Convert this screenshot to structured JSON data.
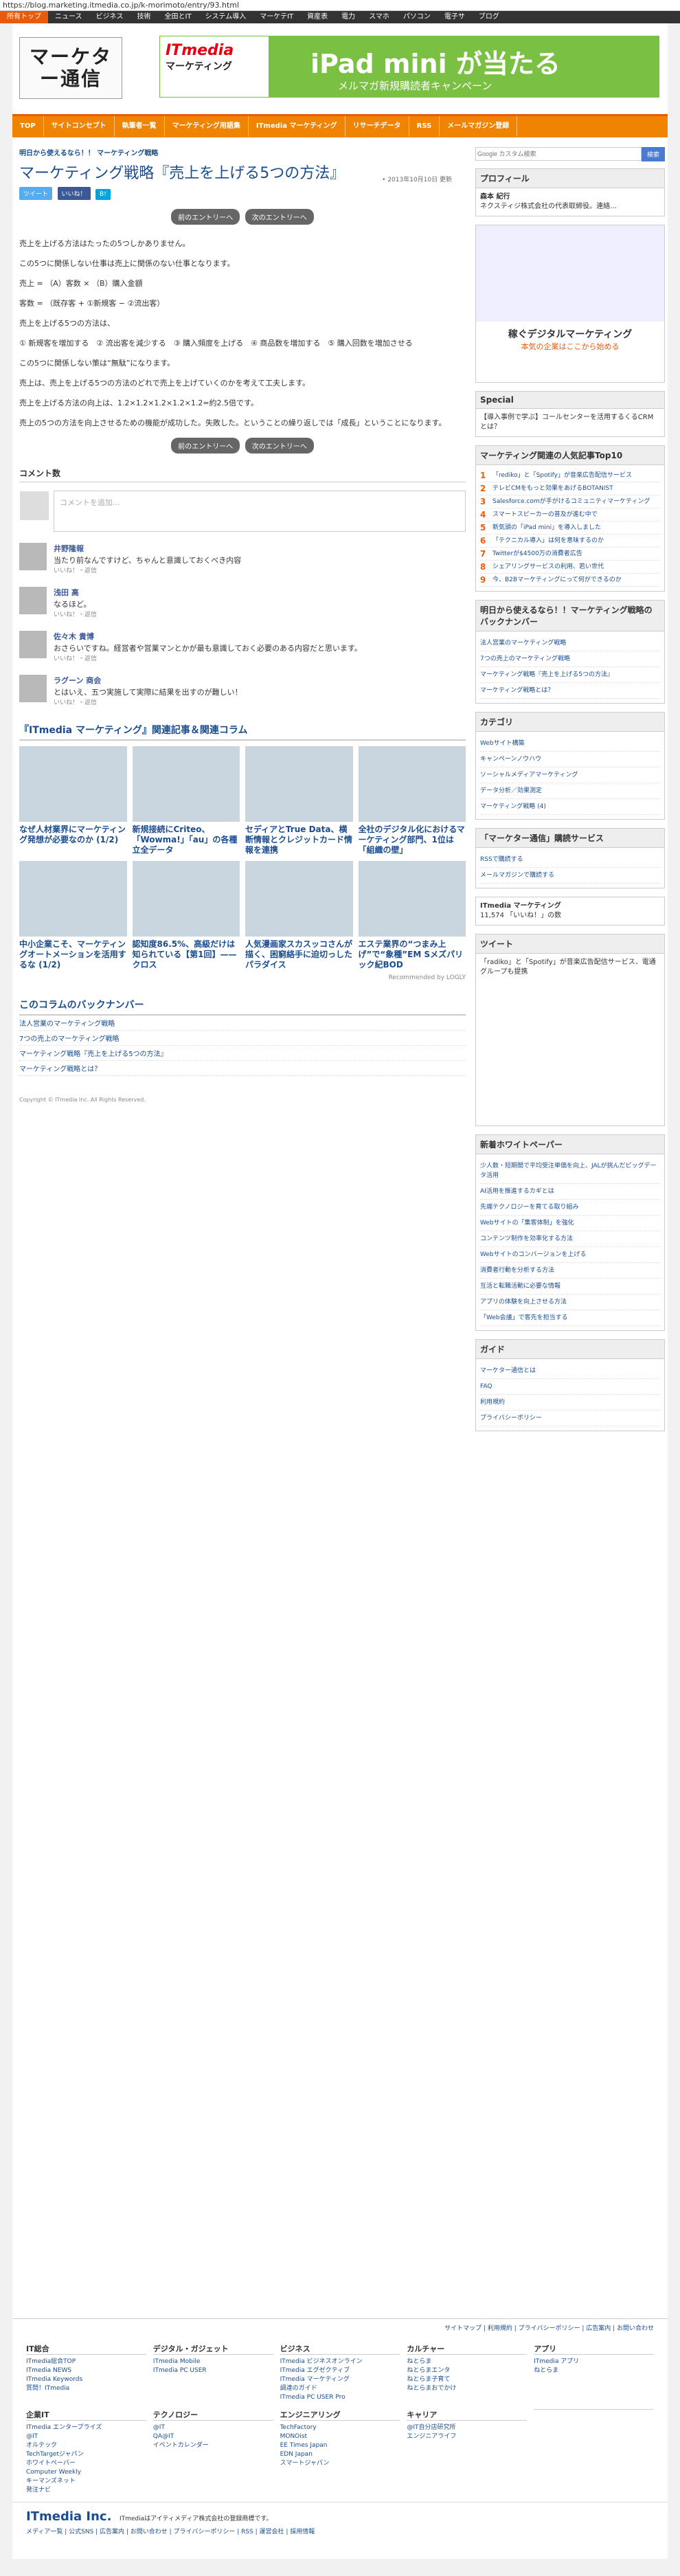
{
  "url": "https://blog.marketing.itmedia.co.jp/k-morimoto/entry/93.html",
  "topnav": [
    "所有トップ",
    "ニュース",
    "ビジネス",
    "技術",
    "全田とIT",
    "システム導入",
    "マーケテIT",
    "資産表",
    "電力",
    "スマホ",
    "パソコン",
    "電子サ",
    "ブログ"
  ],
  "logo": "マーケター通信",
  "banner": {
    "brand1": "ITmedia",
    "brand2": "マーケティング",
    "title": "iPad mini が当たる",
    "sub": "メルマガ新規購読者キャンペーン"
  },
  "orange": [
    "TOP",
    "サイトコンセプト",
    "執筆者一覧",
    "マーケティング用語集",
    "ITmedia マーケティング",
    "リサーチデータ",
    "RSS",
    "メールマガジン登録"
  ],
  "crumb": "明日から使えるなら！！ マーケティング戦略",
  "date": "• 2013年10月10日 更新",
  "title": "マーケティング戦略『売上を上げる5つの方法』",
  "pager": {
    "prev": "前のエントリーへ",
    "next": "次のエントリーへ"
  },
  "body": [
    "売上を上げる方法はたったの5つしかありません。",
    "この5つに関係しない仕事は売上に関係のない仕事となります。",
    "売上 = （A）客数 × （B）購入金額",
    "客数 = （既存客 + ①新規客 − ②流出客）",
    "売上を上げる5つの方法は、",
    "① 新規客を増加する　② 流出客を減少する　③ 購入頻度を上げる　④ 商品数を増加する　⑤ 購入回数を増加させる",
    "この5つに関係しない策は“無駄”になります。",
    "売上は、売上を上げる5つの方法のどれで売上を上げていくのかを考えて工夫します。",
    "売上を上げる方法の向上は、1.2×1.2×1.2×1.2×1.2=約2.5倍です。",
    "売上の5つの方法を向上させるための機能が成功した。失敗した。ということの繰り返しでは「成長」ということになります。"
  ],
  "comments": {
    "header": "コメント数",
    "placeholder": "コメントを追加...",
    "items": [
      {
        "name": "井野隆報",
        "text": "当たり前なんですけど、ちゃんと意識しておくべき内容",
        "meta": "いいね！・返信"
      },
      {
        "name": "浅田 高",
        "text": "なるほど。",
        "meta": "いいね！・返信"
      },
      {
        "name": "佐々木 貴博",
        "text": "おさらいですね。経営者や営業マンとかが最も意識しておく必要のある内容だと思います。",
        "meta": "いいね！・返信"
      },
      {
        "name": "ラグーン 商会",
        "text": "とはいえ、五つ実施して実際に結果を出すのが難しい！",
        "meta": "いいね！・返信"
      }
    ]
  },
  "related": {
    "header": "『ITmedia マーケティング』関連記事＆関連コラム",
    "cards": [
      "なぜ人材業界にマーケティング発想が必要なのか (1/2)",
      "新規接続にCriteo、「Wowma!」「au」の各種立全データ",
      "セディアとTrue Data、横断情報とクレジットカード情報を連携",
      "全社のデジタル化におけるマーケティング部門、1位は「組織の壁」",
      "中小企業こそ、マーケティングオートメーションを活用するな (1/2)",
      "認知度86.5%、高級だけは知られている【第1回】——クロス",
      "人気漫画家スカスッコさんが描く、困窮絡手に迫切っしたパラダイス",
      "エステ業界の“つまみ上げ”で“象種”EM Sメズパリック紀BOD"
    ],
    "recommended": "Recommended by LOGLY"
  },
  "backnum": {
    "header": "このコラムのバックナンバー",
    "items": [
      "法人営業のマーケティング戦略",
      "7つの売上のマーケティング戦略",
      "マーケティング戦略『売上を上げる5つの方法』",
      "マーケティング戦略とは？"
    ]
  },
  "copyright": "Copyright © ITmedia Inc. All Rights Reserved.",
  "side": {
    "search_placeholder": "Google カスタム検索",
    "search_btn": "検索",
    "profile_h": "プロフィール",
    "profile_name": "森本 紀行",
    "profile_text": "ネクスティジ株式会社の代表取締役。連絡…",
    "ad_title": "稼ぐデジタルマーケティング",
    "ad_sub": "本気の企業はここから始める",
    "special_h": "Special",
    "special_item": "【導入事例で学ぶ】コールセンターを活用するくるCRMとは？",
    "rank_h": "マーケティング関連の人気記事Top10",
    "rank": [
      "「rediko」と「Spotify」が音楽広告配信サービス",
      "テレビCMをもっと効果をあげるBOTANIST",
      "Salesforce.comが手がけるコミュニティマーケティング",
      "スマートスピーカーの普及が進む中で",
      "新気頭の「iPad mini」を導入しました",
      "「テクニカル導入」は何を意味するのか",
      "Twitterが$4500万の消費者広告",
      "シェアリングサービスの利用、若い世代",
      "今、B2Bマーケティングにって何ができるのか"
    ],
    "backnum_h": "明日から使えるなら！！マーケティング戦略のバックナンバー",
    "category_h": "カテゴリ",
    "categories": [
      "Webサイト構築",
      "キャンペーンノウハウ",
      "ソーシャルメディアマーケティング",
      "データ分析／効果測定",
      "マーケティング戦略 (4)"
    ],
    "subscribe_h": "「マーケター通信」購読サービス",
    "subscribe": [
      "RSSで購読する",
      "メールマガジンで購読する"
    ],
    "fb_name": "ITmedia マーケティング",
    "fb_count": "11,574 「いいね！」の数",
    "tweets_h": "ツイート",
    "tweet_text": "「radiko」と「Spotify」が音楽広告配信サービス、電通グループも提携",
    "wp_h": "新着ホワイトペーパー",
    "wp": [
      "少人数・短期間で平均受注単価を向上、JALが挑んだビッグデータ活用",
      "AI活用を推進するカギとは",
      "先端テクノロジーを育てる取り組み",
      "Webサイトの「集客体制」を強化",
      "コンテンツ制作を効率化する方法",
      "Webサイトのコンバージョンを上げる",
      "消費者行動を分析する方法",
      "互活と転職活動に必要な情報",
      "アプリの体験を向上させる方法",
      "「Web会議」で客先を担当する"
    ],
    "guide_h": "ガイド",
    "guide": [
      "マーケター通信とは",
      "FAQ",
      "利用規約",
      "プライバシーポリシー"
    ]
  },
  "footer": {
    "links": "サイトマップ | 利用規約 | プライバシーポリシー | 広告案内 | お問い合わせ",
    "cols": [
      {
        "h": "IT総合",
        "items": [
          "ITmedia総合TOP",
          "ITmedia NEWS",
          "ITmedia Keywords",
          "質問！ITmedia"
        ]
      },
      {
        "h": "デジタル・ガジェット",
        "items": [
          "ITmedia Mobile",
          "ITmedia PC USER"
        ]
      },
      {
        "h": "ビジネス",
        "items": [
          "ITmedia ビジネスオンライン",
          "ITmedia エグゼクティブ",
          "ITmedia マーケティング",
          "調達のガイド",
          "ITmedia PC USER Pro"
        ]
      },
      {
        "h": "カルチャー",
        "items": [
          "ねとらま",
          "ねとらまエンタ",
          "ねとらま子育て",
          "ねとらまおでかけ"
        ]
      },
      {
        "h": "アプリ",
        "items": [
          "ITmedia アプリ",
          "ねとらま"
        ]
      },
      {
        "h": "企業IT",
        "items": [
          "ITmedia エンタープライズ",
          "@IT",
          "オルテック",
          "TechTargetジャパン",
          "ホワイトペーパー",
          "Computer Weekly",
          "キーマンズネット",
          "発注ナビ"
        ]
      },
      {
        "h": "テクノロジー",
        "items": [
          "@IT",
          "QA@IT",
          "イベントカレンダー"
        ]
      },
      {
        "h": "エンジニアリング",
        "items": [
          "TechFactory",
          "MONOist",
          "EE Times Japan",
          "EDN Japan",
          "スマートジャパン"
        ]
      },
      {
        "h": "キャリア",
        "items": [
          "@IT自分店研究所",
          "エンジニアライフ"
        ]
      },
      {
        "h": "",
        "items": []
      }
    ],
    "corp": "ITmedia Inc.",
    "corp_text": "ITmediaはアイティメディア株式会社の登録商標です。",
    "bottom": "メディア一覧 | 公式SNS | 広告案内 | お問い合わせ | プライバシーポリシー | RSS | 運営会社 | 採用情報"
  }
}
